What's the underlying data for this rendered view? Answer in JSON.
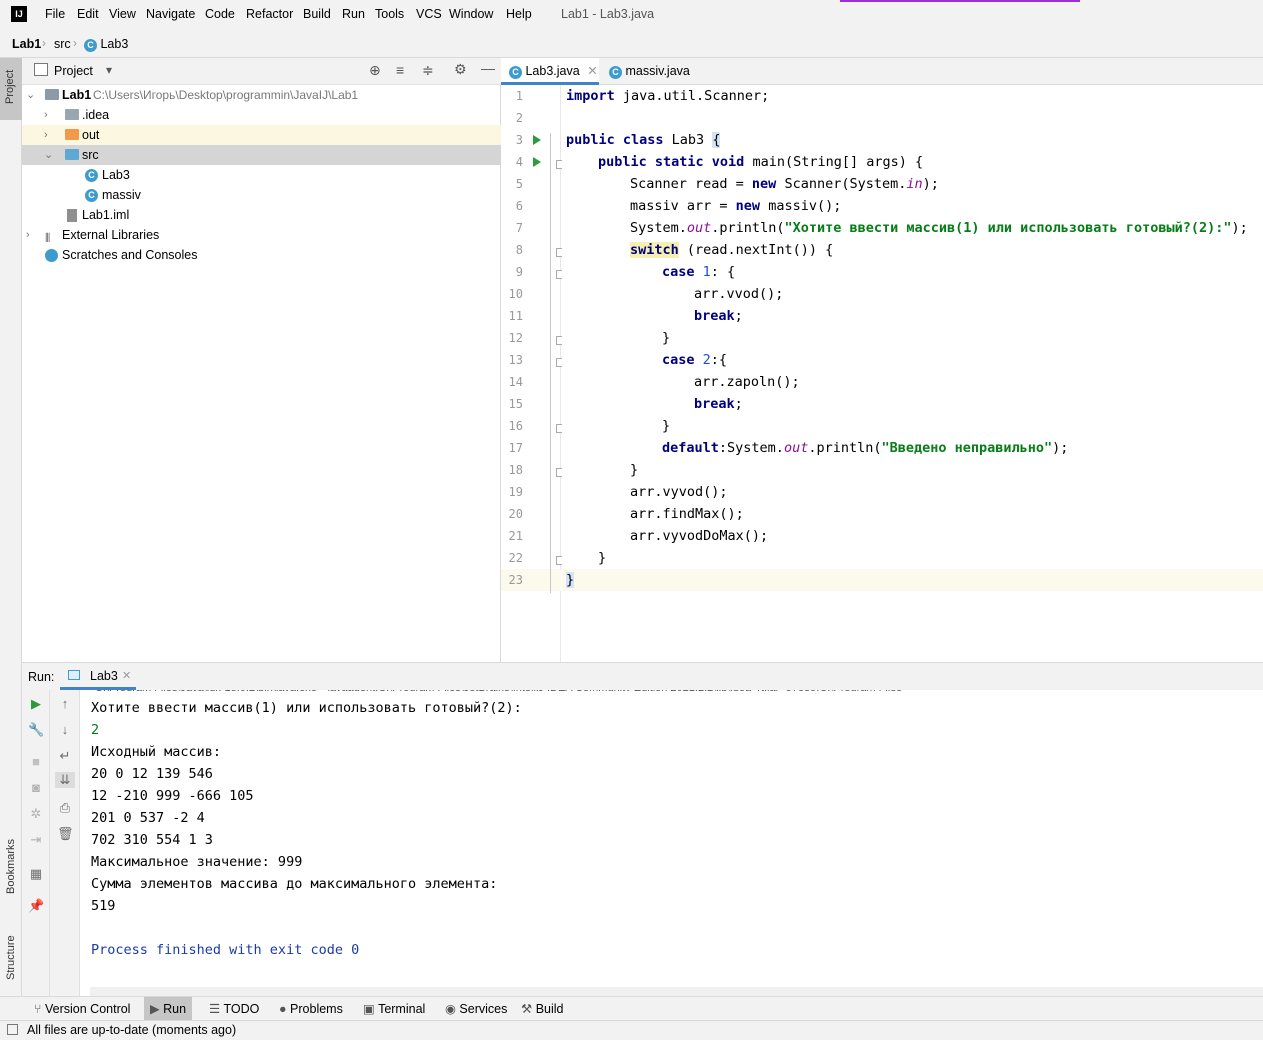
{
  "app": {
    "logo_text": "IJ"
  },
  "menu": [
    "File",
    "Edit",
    "View",
    "Navigate",
    "Code",
    "Refactor",
    "Build",
    "Run",
    "Tools",
    "VCS",
    "Window",
    "Help"
  ],
  "window_title": "Lab1 - Lab3.java",
  "breadcrumb": {
    "project": "Lab1",
    "folder": "src",
    "file": "Lab3"
  },
  "left_stripe": {
    "project_label": "Project",
    "bookmarks_label": "Bookmarks",
    "structure_label": "Structure"
  },
  "project_panel": {
    "title": "Project",
    "tree": {
      "root_name": "Lab1",
      "root_path": "C:\\Users\\Игорь\\Desktop\\programmin\\JavaIJ\\Lab1",
      "idea": ".idea",
      "out": "out",
      "src": "src",
      "lab3": "Lab3",
      "massiv": "massiv",
      "iml": "Lab1.iml",
      "ext_libs": "External Libraries",
      "scratches": "Scratches and Consoles"
    }
  },
  "editor": {
    "tabs": [
      "Lab3.java",
      "massiv.java"
    ],
    "line_numbers": [
      "1",
      "2",
      "3",
      "4",
      "5",
      "6",
      "7",
      "8",
      "9",
      "10",
      "11",
      "12",
      "13",
      "14",
      "15",
      "16",
      "17",
      "18",
      "19",
      "20",
      "21",
      "22",
      "23"
    ],
    "code": {
      "l1_kw": "import",
      "l1_rest": " java.util.Scanner;",
      "l3_kw": "public class",
      "l3_rest": " Lab3 ",
      "l3_brace": "{",
      "l4_kw": "public static void",
      "l4_rest": " main(String[] args) {",
      "l5_a": "Scanner read = ",
      "l5_kw": "new",
      "l5_b": " Scanner(System.",
      "l5_fld": "in",
      "l5_c": ");",
      "l6_a": "massiv arr = ",
      "l6_kw": "new",
      "l6_b": " massiv();",
      "l7_a": "System.",
      "l7_fld": "out",
      "l7_b": ".println(",
      "l7_str": "\"Хотите ввести массив(1) или использовать готовый?(2):\"",
      "l7_c": ");",
      "l8_kw": "switch",
      "l8_rest": " (read.nextInt()) {",
      "l9_kw": "case",
      "l9_num": " 1",
      "l9_rest": ": {",
      "l10": "arr.vvod();",
      "l11_kw": "break",
      "l11_rest": ";",
      "l12": "}",
      "l13_kw": "case",
      "l13_num": " 2",
      "l13_rest": ":{",
      "l14": "arr.zapoln();",
      "l15_kw": "break",
      "l15_rest": ";",
      "l16": "}",
      "l17_kw": "default",
      "l17_a": ":System.",
      "l17_fld": "out",
      "l17_b": ".println(",
      "l17_str": "\"Введено неправильно\"",
      "l17_c": ");",
      "l18": "}",
      "l19": "arr.vyvod();",
      "l20": "arr.findMax();",
      "l21": "arr.vyvodDoMax();",
      "l22": "}",
      "l23": "}"
    }
  },
  "run_panel": {
    "label": "Run:",
    "tab": "Lab3",
    "output": {
      "prompt": "Хотите ввести массив(1) или использовать готовый?(2):",
      "input": "2",
      "l1": "Исходный массив:",
      "l2": "20 0 12 139 546",
      "l3": "12 -210 999 -666 105",
      "l4": "201 0 537 -2 4",
      "l5": "702 310 554 1 3",
      "l6": "Максимальное значение: 999",
      "l7": "Сумма элементов массива до максимального элемента:",
      "l8": "519",
      "exit": "Process finished with exit code 0"
    }
  },
  "bottom_tabs": [
    "Version Control",
    "Run",
    "TODO",
    "Problems",
    "Terminal",
    "Services",
    "Build"
  ],
  "status": "All files are up-to-date (moments ago)",
  "colors": {
    "keyword": "#000080",
    "string": "#067d17",
    "field": "#871094",
    "number": "#1750eb",
    "run_green": "#2e9a3e",
    "folder_orange": "#f2994a",
    "folder_blue": "#5fa8d3"
  }
}
